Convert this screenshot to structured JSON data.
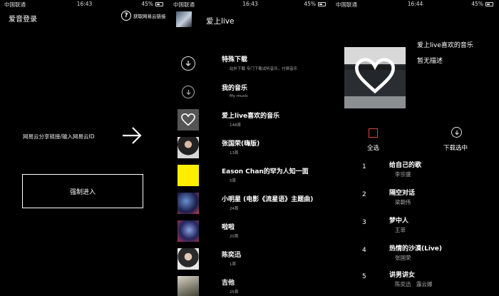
{
  "status": {
    "s1": {
      "carrier": "中国联通",
      "time": "16:43",
      "battery": "45%"
    },
    "s2": {
      "carrier": "中国联通",
      "time": "16:43",
      "battery": "45%"
    },
    "s3": {
      "carrier": "中国联通",
      "time": "16:44",
      "battery": "45%"
    }
  },
  "login": {
    "title": "爱音登录",
    "help_label": "获取网易云链接",
    "hint": "网易云分享链接/输入网易云ID",
    "force_button": "强制进入"
  },
  "library": {
    "user_name": "爱上live",
    "items": [
      {
        "title": "特殊下载",
        "subtitle": "站外下载 专门下载试听音乐，付费音乐",
        "thumb": "download"
      },
      {
        "title": "我的音乐",
        "subtitle": "My music",
        "thumb": "download-small"
      },
      {
        "title": "爱上live喜欢的音乐",
        "subtitle": "148首",
        "thumb": "heart"
      },
      {
        "title": "张国荣(嗨版)",
        "subtitle": "13首",
        "thumb": "photo-man"
      },
      {
        "title": "Eason Chan的罕为人知一面",
        "subtitle": "5首",
        "thumb": "yellow"
      },
      {
        "title": "小明星 (电影《流星语》主题曲)",
        "subtitle": "24首",
        "thumb": "concert"
      },
      {
        "title": "啦啦",
        "subtitle": "20首",
        "thumb": "concert"
      },
      {
        "title": "陈奕迅",
        "subtitle": "1首",
        "thumb": "portrait"
      },
      {
        "title": "吉他",
        "subtitle": "25首",
        "thumb": "guitar"
      }
    ]
  },
  "playlist": {
    "title": "爱上live喜欢的音乐",
    "description": "暂无描述",
    "select_all": "全选",
    "download_selected": "下载选中",
    "songs": [
      {
        "num": "1",
        "title": "给自己的歌",
        "artist": "李宗盛"
      },
      {
        "num": "2",
        "title": "隔空对话",
        "artist": "梁朝伟"
      },
      {
        "num": "3",
        "title": "梦中人",
        "artist": "王菲"
      },
      {
        "num": "4",
        "title": "热情的沙漠(Live)",
        "artist": "张国荣"
      },
      {
        "num": "5",
        "title": "讲男讲女",
        "artist": "陈奕迅　露云娜"
      }
    ]
  },
  "colors": {
    "background": "#000000",
    "checkbox": "#dd4444",
    "yellow_thumb": "#ffee00"
  }
}
